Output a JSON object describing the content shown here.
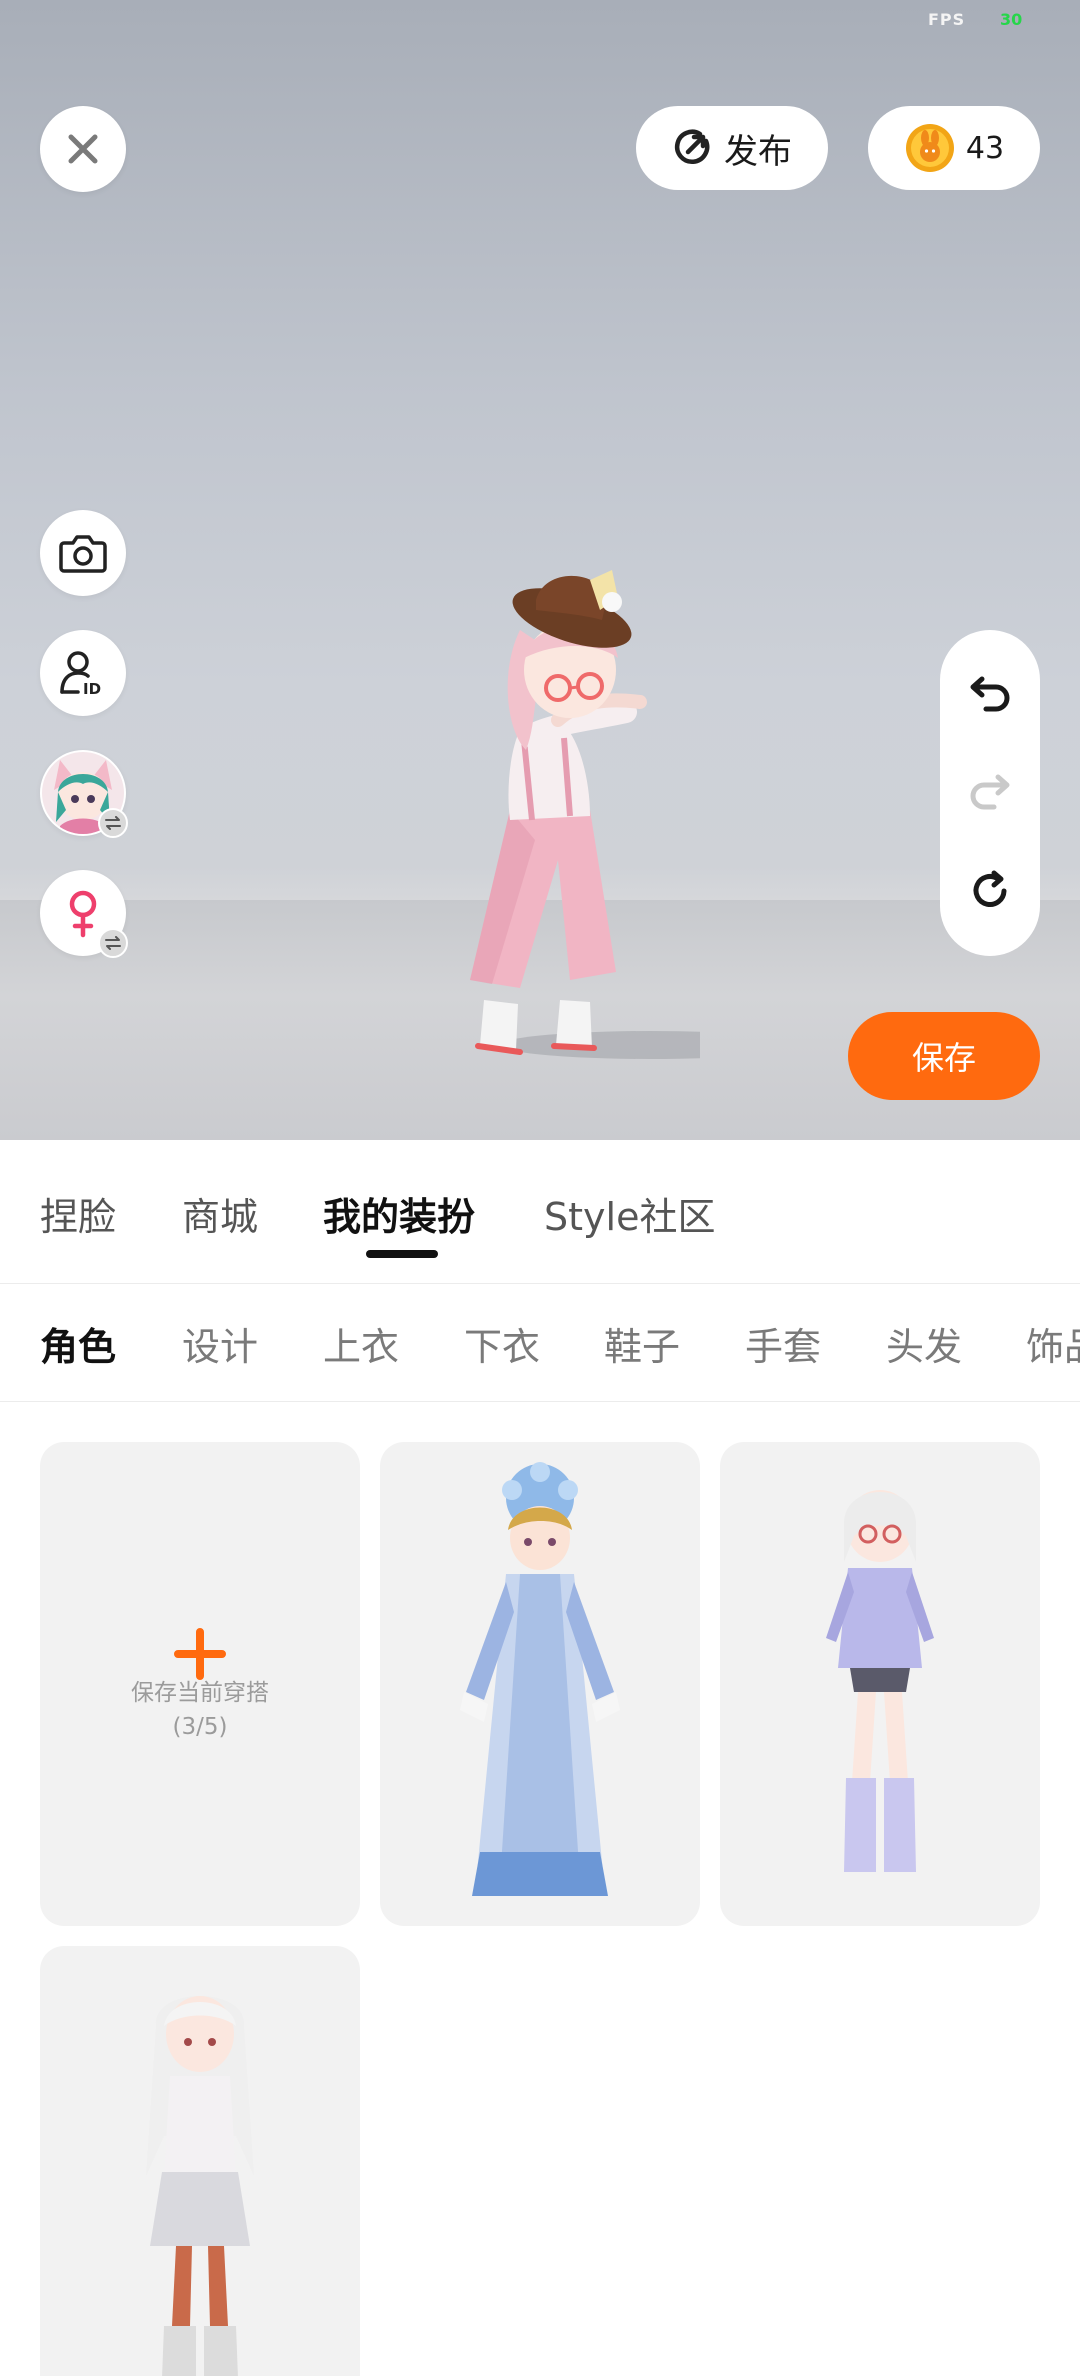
{
  "status": {
    "fps_label": "FPS",
    "fps_value": "30"
  },
  "top_bar": {
    "publish_label": "发布",
    "coin_count": "43"
  },
  "scene_buttons": {
    "save_label": "保存"
  },
  "main_tabs": [
    {
      "label": "捏脸",
      "active": false
    },
    {
      "label": "商城",
      "active": false
    },
    {
      "label": "我的装扮",
      "active": true
    },
    {
      "label": "Style社区",
      "active": false
    }
  ],
  "sub_tabs": [
    {
      "label": "角色",
      "active": true
    },
    {
      "label": "设计",
      "active": false
    },
    {
      "label": "上衣",
      "active": false
    },
    {
      "label": "下衣",
      "active": false
    },
    {
      "label": "鞋子",
      "active": false
    },
    {
      "label": "手套",
      "active": false
    },
    {
      "label": "头发",
      "active": false
    },
    {
      "label": "饰品",
      "active": false
    }
  ],
  "outfit_grid": {
    "add_card": {
      "label": "保存当前穿搭",
      "count": "(3/5)"
    }
  },
  "colors": {
    "accent": "#ff6a0f",
    "fps_green": "#26d64a"
  }
}
